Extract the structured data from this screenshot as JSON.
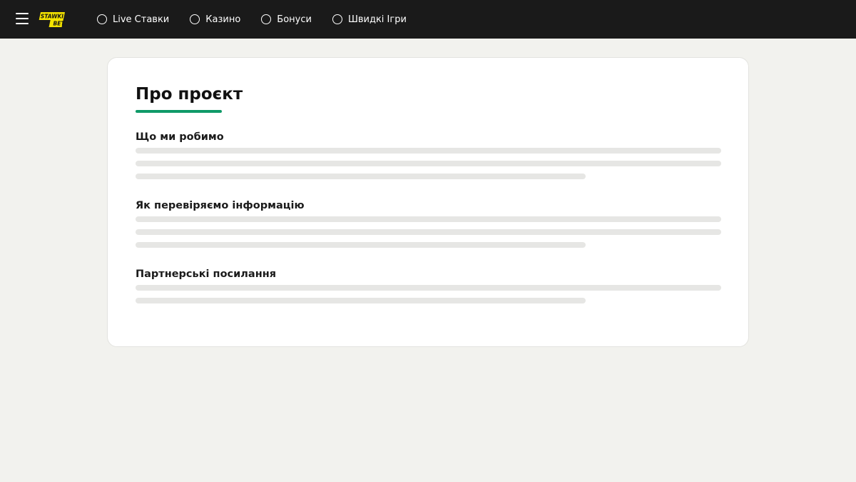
{
  "header": {
    "logo_text_line1": "STAWKI",
    "logo_text_line2": "BET",
    "logo_color": "#f5e400",
    "menu_icon": "hamburger-menu-icon",
    "nav": [
      {
        "label": "Live Ставки",
        "icon": "radio-circle-icon"
      },
      {
        "label": "Казино",
        "icon": "radio-circle-icon"
      },
      {
        "label": "Бонуси",
        "icon": "radio-circle-icon"
      },
      {
        "label": "Швидкі Ігри",
        "icon": "radio-circle-icon"
      }
    ]
  },
  "main": {
    "title": "Про проєкт",
    "accent_color": "#0f9a68",
    "sections": [
      {
        "heading": "Що ми робимо",
        "placeholder_lines": 3
      },
      {
        "heading": "Як перевіряємо інформацію",
        "placeholder_lines": 3
      },
      {
        "heading": "Партнерські посилання",
        "placeholder_lines": 2
      }
    ]
  }
}
